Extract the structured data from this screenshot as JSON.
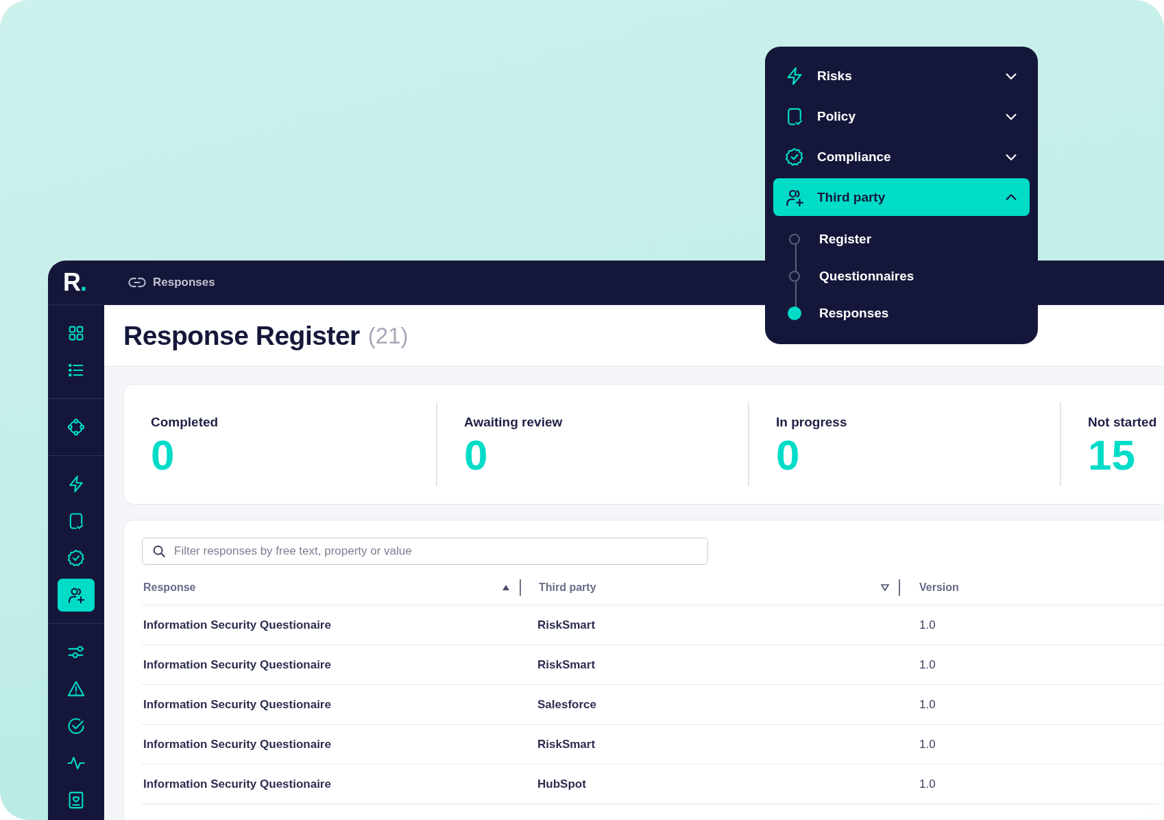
{
  "logo": {
    "letter": "R",
    "mark": "."
  },
  "breadcrumb": "Responses",
  "sidebar": {
    "groups": [
      [
        {
          "kind": "grid",
          "selected": false
        },
        {
          "kind": "list",
          "selected": false
        }
      ],
      [
        {
          "kind": "nodes",
          "selected": false
        }
      ],
      [
        {
          "kind": "bolt",
          "selected": false
        },
        {
          "kind": "doc-check",
          "selected": false
        },
        {
          "kind": "badge-check",
          "selected": false
        },
        {
          "kind": "user-plus",
          "selected": true
        }
      ],
      [
        {
          "kind": "sliders",
          "selected": false
        },
        {
          "kind": "warning",
          "selected": false
        },
        {
          "kind": "check-circle",
          "selected": false
        },
        {
          "kind": "pulse",
          "selected": false
        },
        {
          "kind": "id-card",
          "selected": false
        }
      ]
    ]
  },
  "page": {
    "title": "Response Register",
    "count": "(21)"
  },
  "stats": [
    {
      "label": "Completed",
      "value": "0"
    },
    {
      "label": "Awaiting review",
      "value": "0"
    },
    {
      "label": "In progress",
      "value": "0"
    },
    {
      "label": "Not started",
      "value": "15"
    }
  ],
  "search": {
    "placeholder": "Filter responses by free text, property or value"
  },
  "table": {
    "columns": [
      {
        "label": "Response",
        "ascending": true,
        "sorted": true
      },
      {
        "label": "Third party",
        "ascending": false,
        "sorted": false
      },
      {
        "label": "Version"
      }
    ],
    "rows": [
      [
        "Information Security Questionaire",
        "RiskSmart",
        "1.0"
      ],
      [
        "Information Security Questionaire",
        "RiskSmart",
        "1.0"
      ],
      [
        "Information Security Questionaire",
        "Salesforce",
        "1.0"
      ],
      [
        "Information Security Questionaire",
        "RiskSmart",
        "1.0"
      ],
      [
        "Information Security Questionaire",
        "HubSpot",
        "1.0"
      ]
    ]
  },
  "menu": {
    "items": [
      {
        "label": "Risks",
        "kind": "bolt",
        "expanded": false,
        "selected": false
      },
      {
        "label": "Policy",
        "kind": "doc-check",
        "expanded": false,
        "selected": false
      },
      {
        "label": "Compliance",
        "kind": "badge-check",
        "expanded": false,
        "selected": false
      },
      {
        "label": "Third party",
        "kind": "user-plus",
        "expanded": true,
        "selected": true,
        "children": [
          {
            "label": "Register",
            "selected": false
          },
          {
            "label": "Questionnaires",
            "selected": false
          },
          {
            "label": "Responses",
            "selected": true
          }
        ]
      }
    ]
  }
}
